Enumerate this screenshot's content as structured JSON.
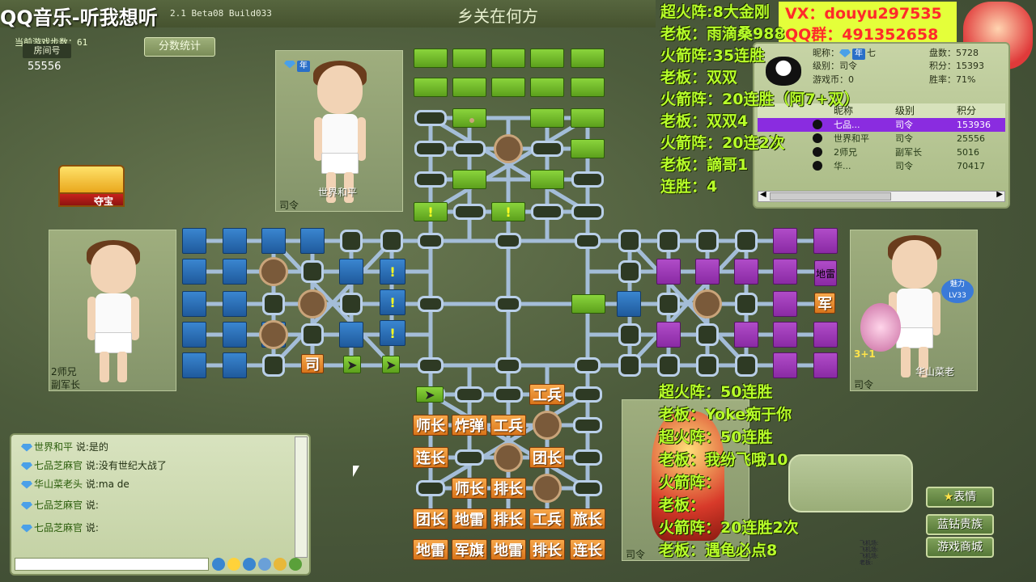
{
  "window": {
    "title": "QQ音乐-听我想听",
    "version": "2.1 Beta08 Build033",
    "game_name": "乡关在何方"
  },
  "room": {
    "label": "房间号",
    "number": "55556",
    "steps": "当前游戏步数：61",
    "stats_button": "分数统计"
  },
  "treasure": {
    "label": "夺宝"
  },
  "players": {
    "top": {
      "name": "世界和平",
      "rank": "司令",
      "tag": "年"
    },
    "left": {
      "name": "2师兄",
      "rank": "副军长"
    },
    "right": {
      "name": "华山菜老",
      "rank": "司令",
      "charm": "魅力",
      "level": "LV33",
      "score": "3+1"
    },
    "bottom": {
      "rank": "司令"
    }
  },
  "contact": {
    "wechat": "VX：douyu297535",
    "qq": "QQ群：491352658"
  },
  "info": {
    "nick_label": "昵称：",
    "nick_val": "七",
    "level_label": "级别：司令",
    "games_label": "盘数：5728",
    "coins_label": "游戏币：0",
    "points_label": "积分：15393",
    "winrate_label": "胜率：71%"
  },
  "list": {
    "headers": [
      "昵称",
      "级别",
      "积分"
    ],
    "rows": [
      {
        "name": "七品...",
        "rank": "司令",
        "points": "153936"
      },
      {
        "name": "世界和平",
        "rank": "司令",
        "points": "25556"
      },
      {
        "name": "2师兄",
        "rank": "副军长",
        "points": "5016"
      },
      {
        "name": "华...",
        "rank": "司令",
        "points": "70417"
      }
    ]
  },
  "stream_top": [
    "超火阵:8大金刚",
    "老板：雨滴桑988",
    "火箭阵:35连胜",
    "老板：双双",
    "火箭阵：20连胜（阿7+双）",
    "老板：双双4",
    "火箭阵：20连2次",
    "老板：謫哥1",
    "连胜：4"
  ],
  "stream_bottom": [
    "超火阵：50连胜",
    "老板：Yoke痴于你",
    "超火阵：50连胜",
    "老板：我纷飞哦10",
    "火箭阵：",
    "老板：",
    "火箭阵：20连胜2次",
    "老板：遇龟必点8"
  ],
  "chat": [
    {
      "name": "世界和平",
      "text": "说:是的"
    },
    {
      "name": "七品芝麻官",
      "text": "说:没有世纪大战了"
    },
    {
      "name": "华山菜老头",
      "text": "说:ma de"
    },
    {
      "name": "七品芝麻官",
      "text": "说:"
    },
    {
      "name": "七品芝麻官",
      "text": "说:"
    }
  ],
  "buttons": {
    "emote": "表情",
    "blue_diamond": "蓝钻贵族",
    "shop": "游戏商城"
  },
  "pieces": {
    "blue": [
      "司"
    ],
    "purple": [
      "地雷",
      "军"
    ],
    "orange": [
      "工兵",
      "师长",
      "炸弹",
      "工兵",
      "连长",
      "团长",
      "师长",
      "排长",
      "团长",
      "地雷",
      "排长",
      "工兵",
      "旅长",
      "地雷",
      "军旗",
      "地雷",
      "排长",
      "连长"
    ]
  },
  "bottom_mini_labels": [
    "飞机场:",
    "飞机场:",
    "飞机场:",
    "老板:"
  ]
}
